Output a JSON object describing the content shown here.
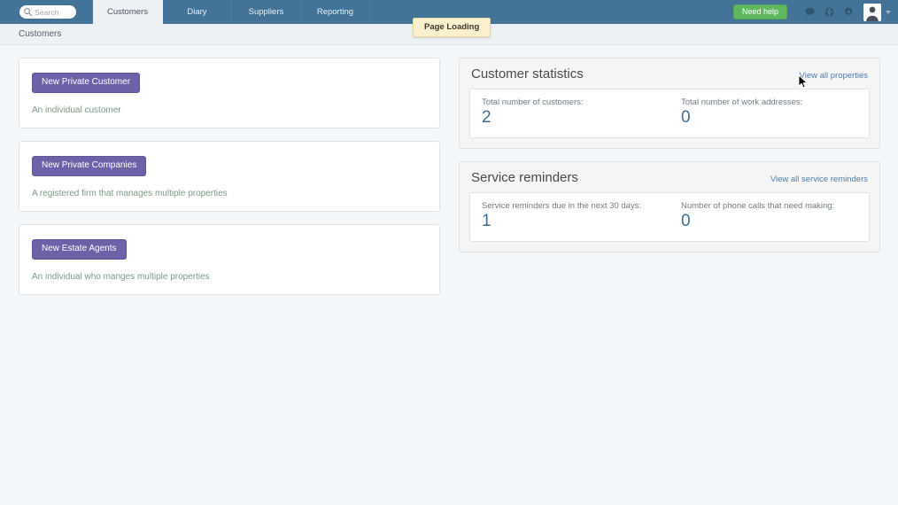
{
  "topbar": {
    "search": {
      "placeholder": "Search",
      "icon": "search-icon"
    },
    "tabs": [
      {
        "label": "Customers",
        "active": true
      },
      {
        "label": "Diary",
        "active": false
      },
      {
        "label": "Suppliers",
        "active": false
      },
      {
        "label": "Reporting",
        "active": false
      }
    ],
    "need_help_label": "Need help",
    "icons": [
      "chat-icon",
      "globe-icon",
      "gear-icon"
    ],
    "avatar": "avatar",
    "accent_bg": "#437396",
    "need_help_color": "#5fb85f"
  },
  "tooltip": {
    "text": "Page Loading"
  },
  "breadcrumb": {
    "text": "Customers"
  },
  "left_cards": [
    {
      "button": "New Private Customer",
      "desc": "An individual customer"
    },
    {
      "button": "New Private Companies",
      "desc": "A registered firm that manages multiple properties"
    },
    {
      "button": "New Estate Agents",
      "desc": "An individual who manges multiple properties"
    }
  ],
  "panels": [
    {
      "title": "Customer statistics",
      "link": "View all properties",
      "stats": [
        {
          "label": "Total number of customers:",
          "value": "2"
        },
        {
          "label": "Total number of work addresses:",
          "value": "0"
        }
      ]
    },
    {
      "title": "Service reminders",
      "link": "View all service reminders",
      "stats": [
        {
          "label": "Service reminders due in the next 30 days:",
          "value": "1"
        },
        {
          "label": "Number of phone calls that need making:",
          "value": "0"
        }
      ]
    }
  ],
  "colors": {
    "page_bg": "#f4f7fa",
    "nav_bg": "#437396",
    "button_purple": "#6b62a8",
    "stat_blue": "#3f6d93",
    "link_blue": "#4f7ea6",
    "desc_green": "#7d9a86"
  }
}
